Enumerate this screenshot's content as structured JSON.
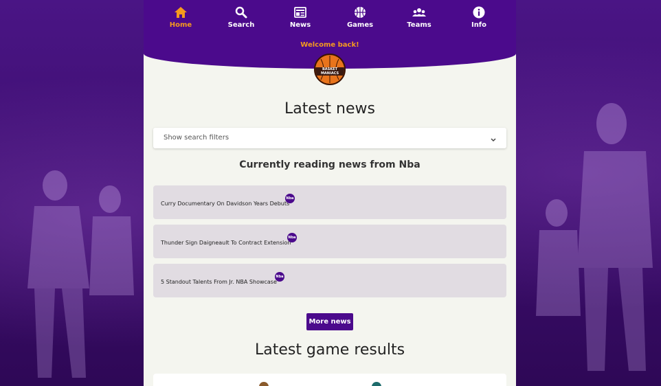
{
  "nav": {
    "items": [
      {
        "label": "Home",
        "icon": "home-icon",
        "active": true
      },
      {
        "label": "Search",
        "icon": "search-icon"
      },
      {
        "label": "News",
        "icon": "news-icon"
      },
      {
        "label": "Games",
        "icon": "basketball-icon"
      },
      {
        "label": "Teams",
        "icon": "teams-icon"
      },
      {
        "label": "Info",
        "icon": "info-icon"
      }
    ]
  },
  "header": {
    "welcome": "Welcome back!",
    "logo_text_line1": "BASKET",
    "logo_text_line2": "MANIACS"
  },
  "news": {
    "title": "Latest news",
    "filters_label": "Show search filters",
    "reading": "Currently reading news from Nba",
    "items": [
      {
        "title": "Curry Documentary On Davidson Years Debuts",
        "badge": "Nba"
      },
      {
        "title": "Thunder Sign Daigneault To Contract Extension",
        "badge": "Nba"
      },
      {
        "title": "5 Standout Talents From Jr. NBA Showcase",
        "badge": "Nba"
      }
    ],
    "more_label": "More news"
  },
  "games": {
    "title": "Latest game results"
  },
  "colors": {
    "primary": "#4b0a8c",
    "accent": "#f59a1e",
    "panel_bg": "#f4f5ef",
    "news_item_bg": "#e1dce2"
  }
}
